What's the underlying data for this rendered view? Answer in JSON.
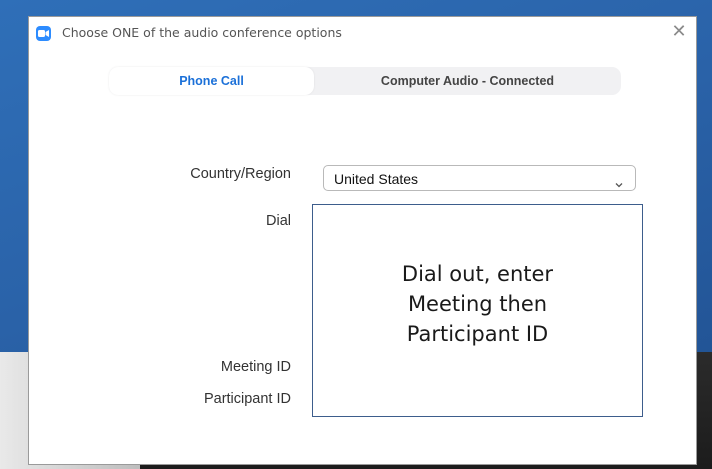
{
  "dialog": {
    "title": "Choose ONE of the audio conference options",
    "close_glyph": "✕",
    "app_icon": "video-camera-icon"
  },
  "tabs": [
    {
      "label": "Phone Call",
      "active": true
    },
    {
      "label": "Computer Audio - Connected",
      "active": false
    }
  ],
  "form": {
    "country_label": "Country/Region",
    "country_value": "United States",
    "dial_label": "Dial",
    "meeting_id_label": "Meeting ID",
    "participant_id_label": "Participant ID"
  },
  "callout": {
    "lines": [
      "Dial out, enter",
      "Meeting then",
      "Participant ID"
    ]
  },
  "colors": {
    "active_tab_text": "#1b70d8",
    "app_icon": "#2d8cff",
    "callout_border": "#3d5d8c"
  }
}
